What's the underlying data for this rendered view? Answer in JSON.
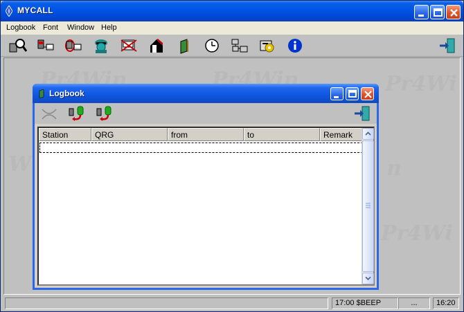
{
  "window": {
    "title": "MYCALL",
    "icon": "diamond-app-icon"
  },
  "menu": [
    {
      "label": "Logbook"
    },
    {
      "label": "Font"
    },
    {
      "label": "Window"
    },
    {
      "label": "Help"
    }
  ],
  "toolbar": {
    "icons": [
      "search-call-icon",
      "terminal-icon",
      "network-icon",
      "hacker-icon",
      "crossed-terminal-icon",
      "house-icon",
      "book-icon",
      "clock-icon",
      "network2-icon",
      "settings-icon",
      "info-icon"
    ],
    "exit_icon": "exit-door-icon"
  },
  "watermark": {
    "text_a": "Pr4Win",
    "text_b": "Pr4Wi",
    "text_c": "W",
    "text_d": "n"
  },
  "logbook": {
    "title": "Logbook",
    "columns": [
      "Station",
      "QRG",
      "from",
      "to",
      "Remark"
    ],
    "rows": []
  },
  "status": {
    "left": "",
    "time_callsign": "17:00 $BEEP",
    "extra": "...",
    "clock": "16:20"
  },
  "colors": {
    "titlebar": "#0054e3",
    "close": "#e0542a",
    "client_bg": "#c0c0c0"
  }
}
